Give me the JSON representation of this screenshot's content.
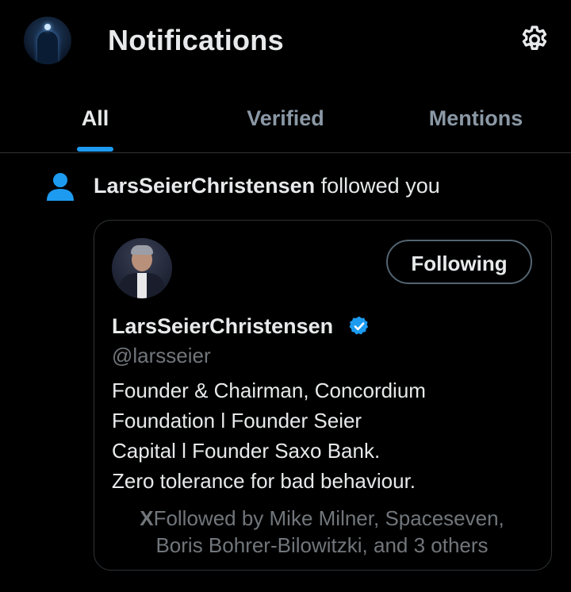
{
  "header": {
    "title": "Notifications",
    "avatar_icon": "user-avatar",
    "settings_icon": "gear-icon"
  },
  "tabs": [
    {
      "label": "All",
      "active": true
    },
    {
      "label": "Verified",
      "active": false
    },
    {
      "label": "Mentions",
      "active": false
    }
  ],
  "notification": {
    "icon": "person-icon",
    "actor_name": "LarsSeierChristensen",
    "action_text": " followed you",
    "card": {
      "display_name": "LarsSeierChristensen",
      "verified_icon": "verified-badge-icon",
      "handle": "@larsseier",
      "follow_button_label": "Following",
      "bio_lines": [
        "Founder & Chairman, Concordium",
        "Foundation l Founder Seier",
        "Capital l Founder Saxo Bank.",
        "Zero tolerance for bad behaviour."
      ],
      "followed_by_glyph": "X",
      "followed_by_lines": [
        "Followed by Mike Milner, Spaceseven,",
        "Boris Bohrer-Bilowitzki, and 3 others"
      ]
    }
  },
  "colors": {
    "accent": "#1d9bf0",
    "background": "#000000",
    "muted_text": "#71767b",
    "border": "#2f3336"
  }
}
